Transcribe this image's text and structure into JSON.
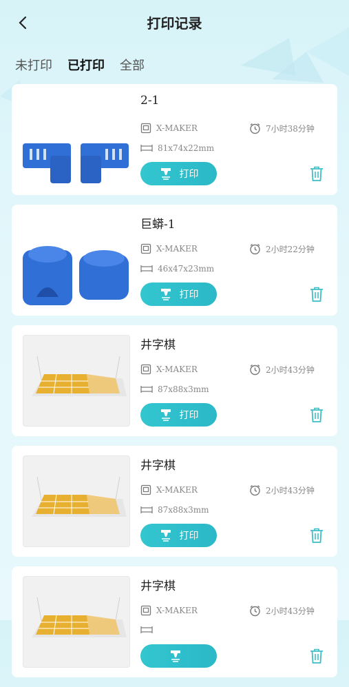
{
  "header": {
    "title": "打印记录",
    "back_icon": "chevron-left-icon"
  },
  "tabs": [
    {
      "label": "未打印",
      "active": false
    },
    {
      "label": "已打印",
      "active": true
    },
    {
      "label": "全部",
      "active": false
    }
  ],
  "records": [
    {
      "name": "2-1",
      "printer": "X-MAKER",
      "dims": "81x74x22mm",
      "time": "7小时38分钟",
      "print_label": "打印",
      "thumb": "blue-parts"
    },
    {
      "name": "巨蟒-1",
      "printer": "X-MAKER",
      "dims": "46x47x23mm",
      "time": "2小时22分钟",
      "print_label": "打印",
      "thumb": "blue-blocks"
    },
    {
      "name": "井字棋",
      "printer": "X-MAKER",
      "dims": "87x88x3mm",
      "time": "2小时43分钟",
      "print_label": "打印",
      "thumb": "yellow-board"
    },
    {
      "name": "井字棋",
      "printer": "X-MAKER",
      "dims": "87x88x3mm",
      "time": "2小时43分钟",
      "print_label": "打印",
      "thumb": "yellow-board"
    },
    {
      "name": "井字棋",
      "printer": "X-MAKER",
      "dims": "",
      "time": "2小时43分钟",
      "print_label": "",
      "thumb": "yellow-board"
    }
  ],
  "colors": {
    "accent": "#2fc0cb",
    "model_blue": "#2f6fd6",
    "board_yellow": "#e8b030"
  }
}
